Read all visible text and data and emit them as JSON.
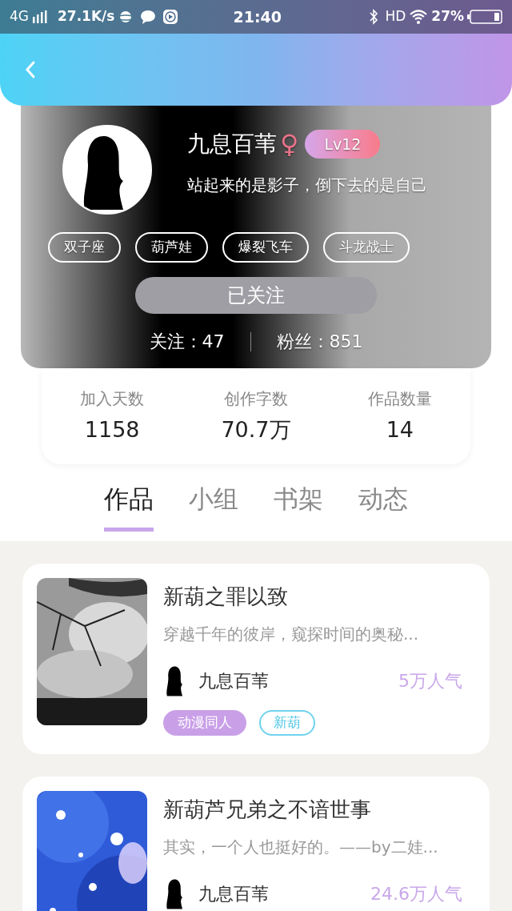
{
  "status_bar": {
    "network": "4G",
    "speed": "27.1K/s",
    "time": "21:40",
    "hd": "HD",
    "battery": "27%"
  },
  "profile": {
    "name": "九息百苇",
    "gender": "♀",
    "level": "Lv12",
    "bio": "站起来的是影子，倒下去的是自己",
    "tags": [
      "双子座",
      "葫芦娃",
      "爆裂飞车",
      "斗龙战士"
    ],
    "follow_button": {
      "label": "已关注",
      "selected": true
    },
    "following": "关注：47",
    "followers": "粉丝：851"
  },
  "stats": [
    {
      "label": "加入天数",
      "value": "1158"
    },
    {
      "label": "创作字数",
      "value": "70.7万"
    },
    {
      "label": "作品数量",
      "value": "14"
    }
  ],
  "tabs": [
    {
      "label": "作品",
      "selected": true
    },
    {
      "label": "小组",
      "selected": false
    },
    {
      "label": "书架",
      "selected": false
    },
    {
      "label": "动态",
      "selected": false
    }
  ],
  "works": [
    {
      "title": "新葫之罪以致",
      "summary": "穿越千年的彼岸，窥探时间的奥秘...",
      "author": "九息百苇",
      "popularity": "5万人气",
      "tags": [
        {
          "label": "动漫同人",
          "kind": "filled"
        },
        {
          "label": "新葫",
          "kind": "outline"
        }
      ]
    },
    {
      "title": "新葫芦兄弟之不谙世事",
      "summary": "其实，一个人也挺好的。——by二娃...",
      "author": "九息百苇",
      "popularity": "24.6万人气"
    }
  ]
}
